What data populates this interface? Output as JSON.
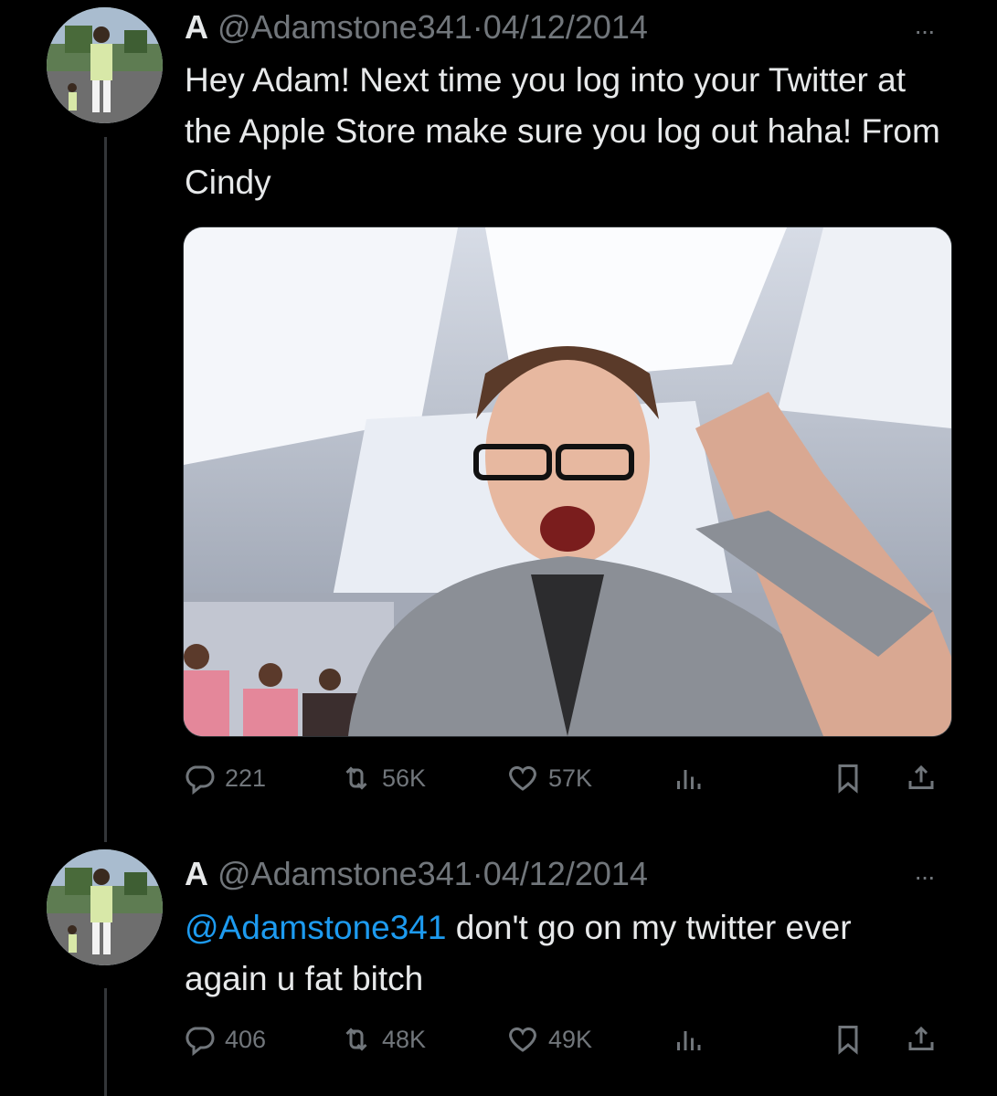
{
  "tweets": [
    {
      "author_name": "A",
      "handle": "@Adamstone341",
      "separator": "·",
      "date": "04/12/2014",
      "more_label": "···",
      "text": "Hey Adam! Next time you log into your Twitter at the Apple Store make sure you log out haha! From Cindy",
      "replies": "221",
      "retweets": "56K",
      "likes": "57K",
      "has_media": true
    },
    {
      "author_name": "A",
      "handle": "@Adamstone341",
      "separator": "·",
      "date": "04/12/2014",
      "more_label": "···",
      "mention": "@Adamstone341",
      "text": " don't go on my twitter ever again u fat bitch",
      "replies": "406",
      "retweets": "48K",
      "likes": "49K",
      "has_media": false
    }
  ],
  "icons": {
    "reply": "reply-icon",
    "retweet": "retweet-icon",
    "like": "heart-icon",
    "views": "views-icon",
    "bookmark": "bookmark-icon",
    "share": "share-icon"
  },
  "colors": {
    "background": "#000000",
    "text": "#e7e9ea",
    "muted": "#71767b",
    "link": "#1d9bf0"
  }
}
